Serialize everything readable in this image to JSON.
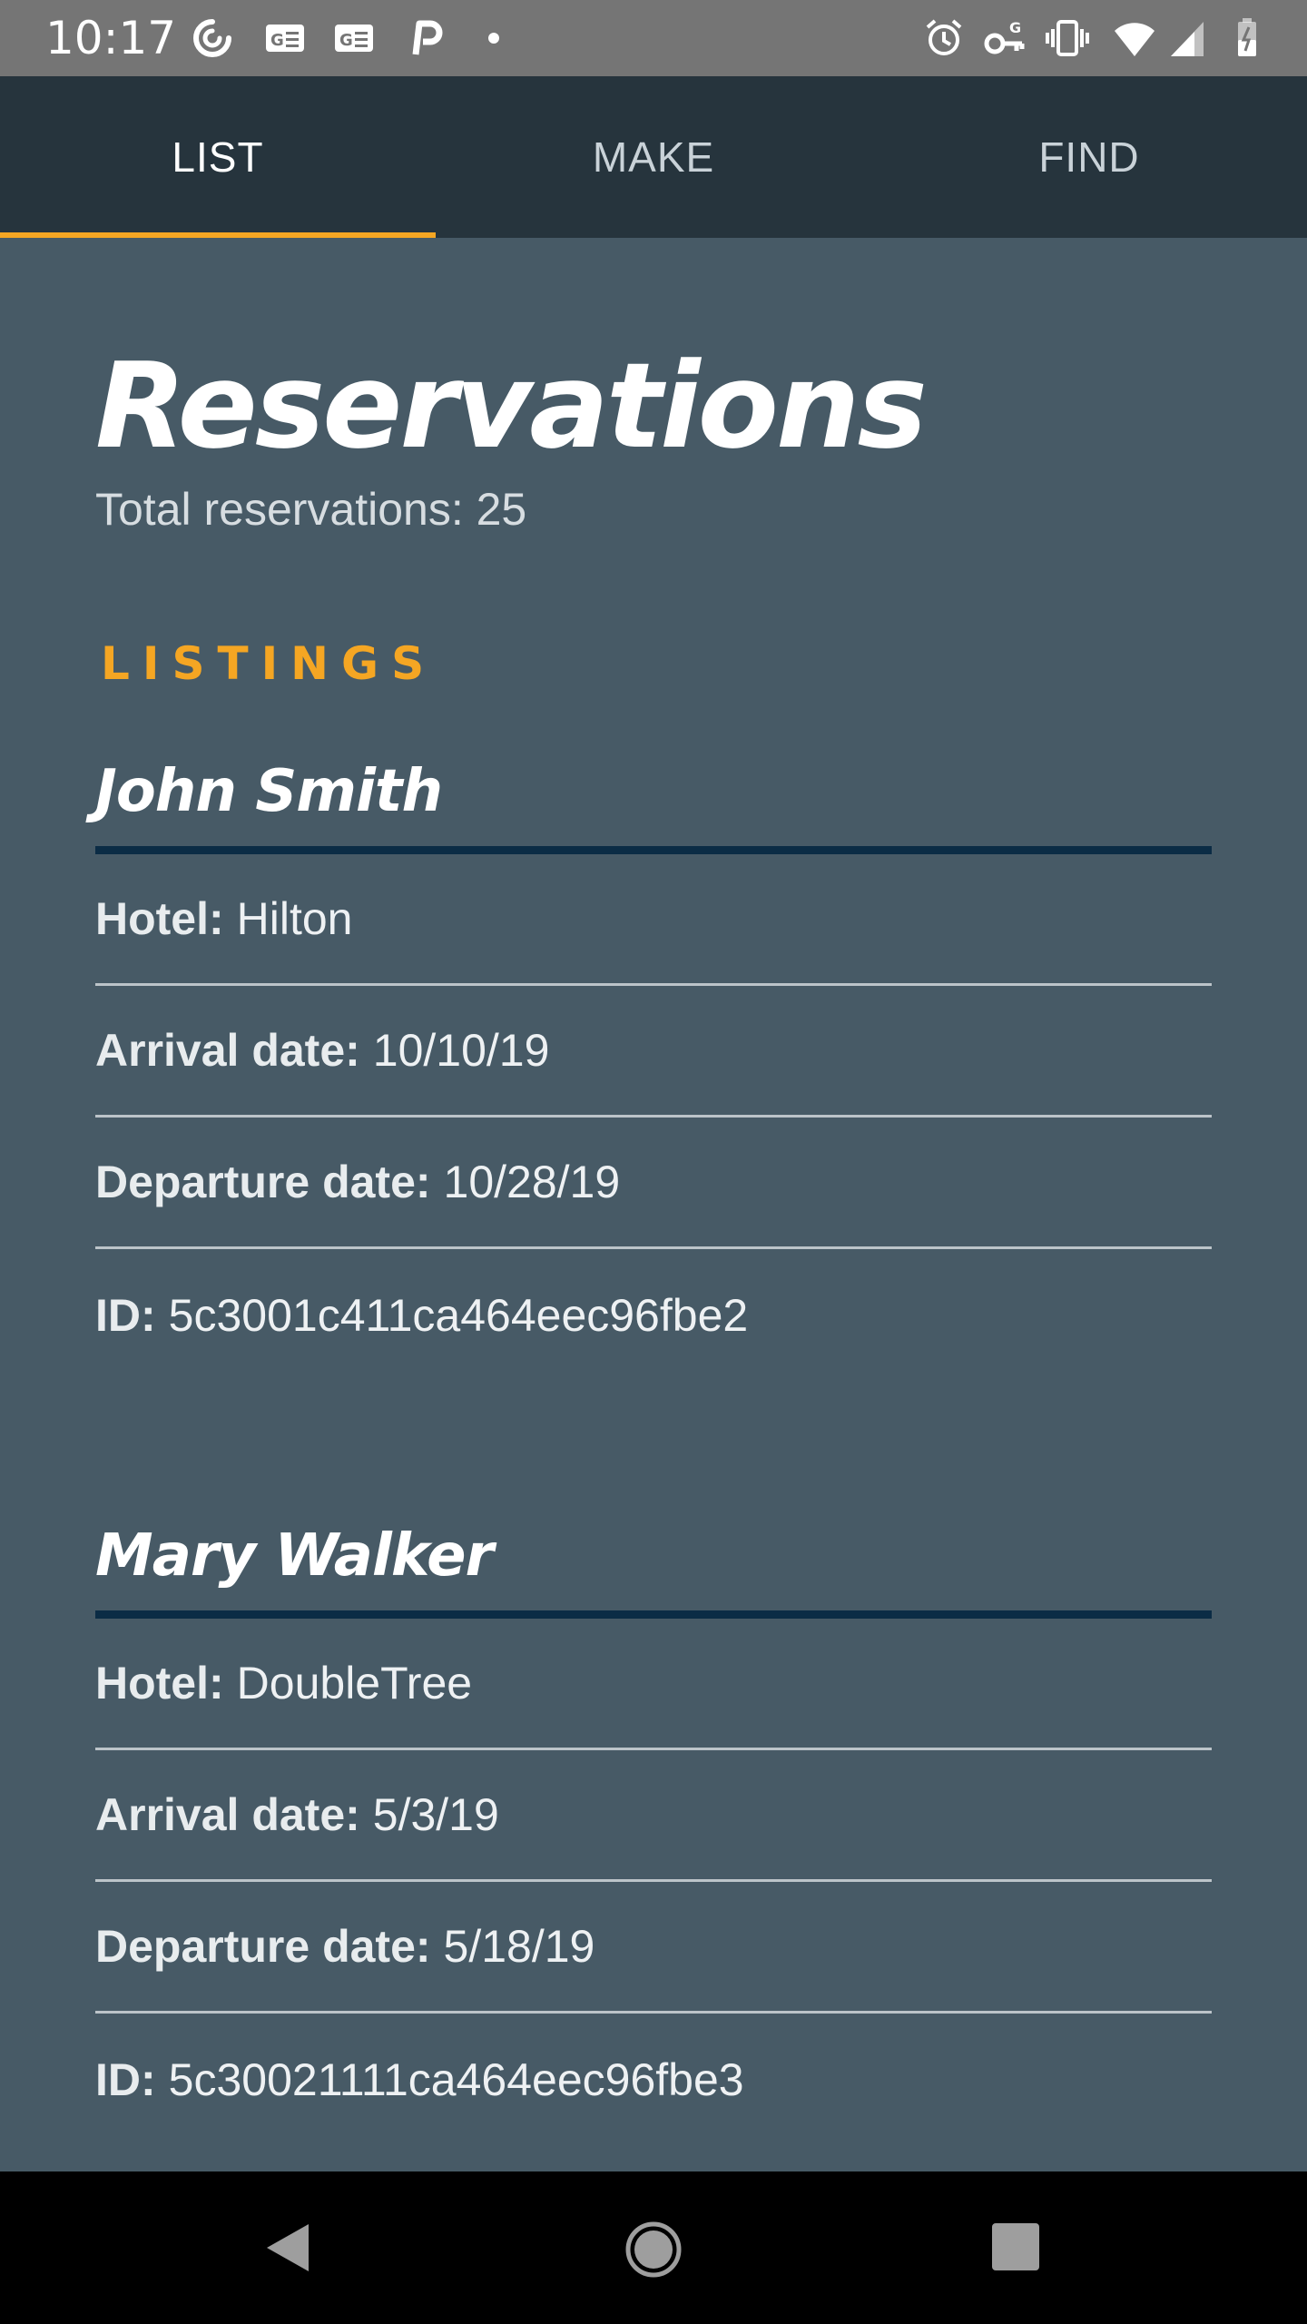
{
  "status_bar": {
    "time": "10:17",
    "left_icons": [
      "sync-icon",
      "news-icon",
      "news-icon",
      "parking-icon",
      "dot-icon"
    ],
    "right_icons": [
      "alarm-icon",
      "vpn-key-icon",
      "vibrate-icon",
      "wifi-icon",
      "signal-icon",
      "battery-icon"
    ]
  },
  "tabs": [
    {
      "label": "LIST",
      "active": true
    },
    {
      "label": "MAKE",
      "active": false
    },
    {
      "label": "FIND",
      "active": false
    }
  ],
  "page": {
    "title": "Reservations",
    "total_text": "Total reservations: 25",
    "section_label": "LISTINGS"
  },
  "reservations": [
    {
      "name": "John Smith",
      "hotel_label": "Hotel:",
      "hotel": "Hilton",
      "arrival_label": "Arrival date:",
      "arrival": "10/10/19",
      "departure_label": "Departure date:",
      "departure": "10/28/19",
      "id_label": "ID:",
      "id": "5c3001c411ca464eec96fbe2"
    },
    {
      "name": "Mary Walker",
      "hotel_label": "Hotel:",
      "hotel": "DoubleTree",
      "arrival_label": "Arrival date:",
      "arrival": "5/3/19",
      "departure_label": "Departure date:",
      "departure": "5/18/19",
      "id_label": "ID:",
      "id": "5c30021111ca464eec96fbe3"
    }
  ],
  "colors": {
    "accent": "#f5a623",
    "background": "#475a66",
    "tabbar": "#26343d",
    "status_bar": "#757575",
    "name_rule": "#0b2c45"
  }
}
